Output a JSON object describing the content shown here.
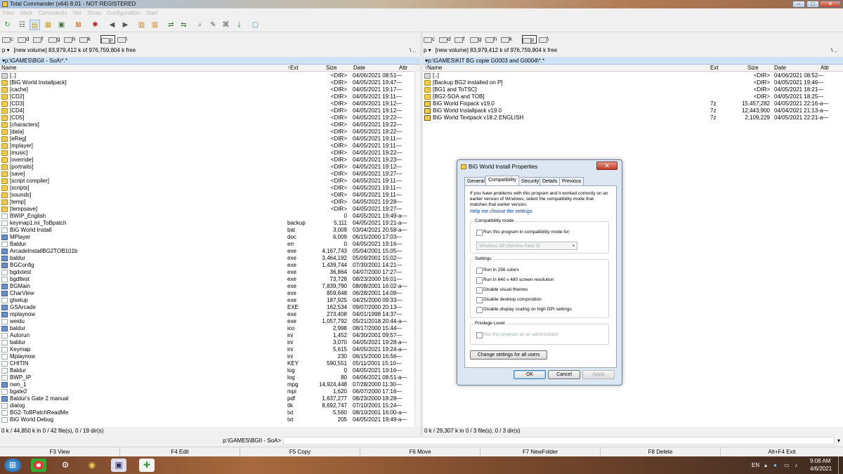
{
  "window": {
    "title": "Total Commander (x64) 8.01 - NOT REGISTERED",
    "min": "–",
    "max": "□",
    "close": "✕"
  },
  "menu": [
    "Files",
    "Mark",
    "Commands",
    "Net",
    "Show",
    "Configuration",
    "Start"
  ],
  "drives": [
    "c",
    "d",
    "f",
    "g",
    "h",
    "k",
    "p",
    "\\"
  ],
  "selected_drive": "p",
  "left": {
    "drive_sel": "p",
    "volume": "[new volume]  83,979,412 k of 976,759,804 k free",
    "path": "▾p:\\GAMES\\BGII - SoA\\*.*",
    "cols": {
      "name": "Name",
      "ext": "↑Ext",
      "size": "Size",
      "date": "Date",
      "attr": "Attr"
    },
    "rows": [
      {
        "i": "up",
        "n": "[..]",
        "e": "",
        "s": "<DIR>",
        "d": "04/06/2021 08:51—"
      },
      {
        "i": "folder",
        "n": "[BiG World Installpack]",
        "e": "",
        "s": "<DIR>",
        "d": "04/05/2021 19:47—"
      },
      {
        "i": "folder",
        "n": "[cache]",
        "e": "",
        "s": "<DIR>",
        "d": "04/05/2021 19:17—"
      },
      {
        "i": "folder",
        "n": "[CD2]",
        "e": "",
        "s": "<DIR>",
        "d": "04/05/2021 19:11—"
      },
      {
        "i": "folder",
        "n": "[CD3]",
        "e": "",
        "s": "<DIR>",
        "d": "04/05/2021 19:12—"
      },
      {
        "i": "folder",
        "n": "[CD4]",
        "e": "",
        "s": "<DIR>",
        "d": "04/05/2021 19:12—"
      },
      {
        "i": "folder",
        "n": "[CD5]",
        "e": "",
        "s": "<DIR>",
        "d": "04/05/2021 19:22—"
      },
      {
        "i": "folder",
        "n": "[characters]",
        "e": "",
        "s": "<DIR>",
        "d": "04/05/2021 19:22—"
      },
      {
        "i": "folder",
        "n": "[data]",
        "e": "",
        "s": "<DIR>",
        "d": "04/05/2021 19:22—"
      },
      {
        "i": "folder",
        "n": "[eReg]",
        "e": "",
        "s": "<DIR>",
        "d": "04/05/2021 19:11—"
      },
      {
        "i": "folder",
        "n": "[mplayer]",
        "e": "",
        "s": "<DIR>",
        "d": "04/05/2021 19:11—"
      },
      {
        "i": "folder",
        "n": "[music]",
        "e": "",
        "s": "<DIR>",
        "d": "04/05/2021 19:22—"
      },
      {
        "i": "folder",
        "n": "[override]",
        "e": "",
        "s": "<DIR>",
        "d": "04/05/2021 19:23—"
      },
      {
        "i": "folder",
        "n": "[portraits]",
        "e": "",
        "s": "<DIR>",
        "d": "04/05/2021 19:12—"
      },
      {
        "i": "folder",
        "n": "[save]",
        "e": "",
        "s": "<DIR>",
        "d": "04/05/2021 19:27—"
      },
      {
        "i": "folder",
        "n": "[script compiler]",
        "e": "",
        "s": "<DIR>",
        "d": "04/05/2021 19:11—"
      },
      {
        "i": "folder",
        "n": "[scripts]",
        "e": "",
        "s": "<DIR>",
        "d": "04/05/2021 19:11—"
      },
      {
        "i": "folder",
        "n": "[sounds]",
        "e": "",
        "s": "<DIR>",
        "d": "04/05/2021 19:11—"
      },
      {
        "i": "folder",
        "n": "[temp]",
        "e": "",
        "s": "<DIR>",
        "d": "04/05/2021 19:28—"
      },
      {
        "i": "folder",
        "n": "[tempsave]",
        "e": "",
        "s": "<DIR>",
        "d": "04/05/2021 19:27—"
      },
      {
        "i": "file",
        "n": "BWIP_English",
        "e": "",
        "s": "0",
        "d": "04/05/2021 19:49-a—"
      },
      {
        "i": "file",
        "n": "keymap1.ini_ToBpatch",
        "e": "backup",
        "s": "5,111",
        "d": "04/05/2021 19:21-a—"
      },
      {
        "i": "file",
        "n": "BiG World Install",
        "e": "bat",
        "s": "3,009",
        "d": "03/04/2021 20:58-a—"
      },
      {
        "i": "exe",
        "n": "MPlayer",
        "e": "doc",
        "s": "6,009",
        "d": "06/15/2000 17:03—"
      },
      {
        "i": "file",
        "n": "Baldur",
        "e": "err",
        "s": "0",
        "d": "04/05/2021 19:16—"
      },
      {
        "i": "exe",
        "n": "ArcadeInstallBG2TOB101b",
        "e": "exe",
        "s": "4,167,743",
        "d": "05/04/2001 15:05—"
      },
      {
        "i": "exe",
        "n": "baldur",
        "e": "exe",
        "s": "3,464,192",
        "d": "05/09/2001 15:02—"
      },
      {
        "i": "exe",
        "n": "BGConfig",
        "e": "exe",
        "s": "1,439,744",
        "d": "07/30/2001 14:21—"
      },
      {
        "i": "file",
        "n": "bgdxtest",
        "e": "exe",
        "s": "36,864",
        "d": "04/07/2000 17:27—"
      },
      {
        "i": "file",
        "n": "bgdltest",
        "e": "exe",
        "s": "73,728",
        "d": "08/23/2000 16:01—"
      },
      {
        "i": "exe",
        "n": "BGMain",
        "e": "exe",
        "s": "7,839,790",
        "d": "08/08/2001 16:02-a—"
      },
      {
        "i": "exe",
        "n": "CharView",
        "e": "exe",
        "s": "859,648",
        "d": "06/28/2001 14:09—"
      },
      {
        "i": "file",
        "n": "glsetup",
        "e": "exe",
        "s": "187,925",
        "d": "04/25/2000 09:33—"
      },
      {
        "i": "exe",
        "n": "GSArcade",
        "e": "EXE",
        "s": "162,534",
        "d": "09/07/2000 20:13—"
      },
      {
        "i": "exe",
        "n": "mplaynow",
        "e": "exe",
        "s": "273,408",
        "d": "04/01/1998 14:37—"
      },
      {
        "i": "file",
        "n": "weidu",
        "e": "exe",
        "s": "1,057,792",
        "d": "05/21/2018 20:44-a—"
      },
      {
        "i": "exe",
        "n": "baldur",
        "e": "ico",
        "s": "2,998",
        "d": "08/17/2000 15:44—"
      },
      {
        "i": "file",
        "n": "Autorun",
        "e": "ini",
        "s": "1,452",
        "d": "04/30/2001 09:57—"
      },
      {
        "i": "file",
        "n": "baldur",
        "e": "ini",
        "s": "3,070",
        "d": "04/05/2021 19:28-a—"
      },
      {
        "i": "file",
        "n": "Keymap",
        "e": "ini",
        "s": "5,615",
        "d": "04/05/2021 19:24-a—"
      },
      {
        "i": "file",
        "n": "Mplaynow",
        "e": "ini",
        "s": "230",
        "d": "06/15/2000 16:56—"
      },
      {
        "i": "file",
        "n": "CHITIN",
        "e": "KEY",
        "s": "590,551",
        "d": "05/11/2001 15:10—"
      },
      {
        "i": "file",
        "n": "Baldur",
        "e": "log",
        "s": "0",
        "d": "04/05/2021 19:16—"
      },
      {
        "i": "file",
        "n": "BWP_IP",
        "e": "log",
        "s": "80",
        "d": "04/06/2021 08:51-a—"
      },
      {
        "i": "exe",
        "n": "nwn_1",
        "e": "mpg",
        "s": "14,924,448",
        "d": "07/28/2000 11:30—"
      },
      {
        "i": "file",
        "n": "bgate2",
        "e": "mpi",
        "s": "1,620",
        "d": "06/07/2000 17:16—"
      },
      {
        "i": "exe",
        "n": "Baldur's Gate 2 manual",
        "e": "pdf",
        "s": "1,637,277",
        "d": "08/23/2000 18:28—"
      },
      {
        "i": "file",
        "n": "dialog",
        "e": "tlk",
        "s": "8,692,747",
        "d": "07/10/2001 15:24—"
      },
      {
        "i": "file",
        "n": "BG2-ToBPatchReadMe",
        "e": "txt",
        "s": "5,560",
        "d": "08/10/2001 16:00-a—"
      },
      {
        "i": "file",
        "n": "BiG World Debug",
        "e": "txt",
        "s": "205",
        "d": "04/05/2021 19:49-a—"
      }
    ],
    "status": "0 k / 44,850 k in 0 / 42 file(s), 0 / 19 dir(s)"
  },
  "right": {
    "drive_sel": "p",
    "volume": "[new volume]  83,979,412 k of 976,759,804 k free",
    "path": "▾p:\\GAMES\\KIT BG copie G0003 and G0004\\*.*",
    "cols": {
      "name": "↑Name",
      "ext": "Ext",
      "size": "Size",
      "date": "Date",
      "attr": "Attr"
    },
    "rows": [
      {
        "i": "up",
        "n": "[..]",
        "e": "",
        "s": "<DIR>",
        "d": "04/06/2021 08:52—"
      },
      {
        "i": "folder",
        "n": "[Backup BG2 installed on P]",
        "e": "",
        "s": "<DIR>",
        "d": "04/05/2021 19:46—"
      },
      {
        "i": "folder",
        "n": "[BG1 and ToTSC]",
        "e": "",
        "s": "<DIR>",
        "d": "04/05/2021 18:21—"
      },
      {
        "i": "folder",
        "n": "[BG2-SOA and TOB]",
        "e": "",
        "s": "<DIR>",
        "d": "04/05/2021 18:25—"
      },
      {
        "i": "zip",
        "n": "BiG World Fixpack v19.0",
        "e": "7z",
        "s": "15,457,282",
        "d": "04/05/2021 22:16-a—"
      },
      {
        "i": "zip",
        "n": "BiG World Installpack v19.0",
        "e": "7z",
        "s": "12,443,900",
        "d": "04/04/2021 21:13-a—"
      },
      {
        "i": "zip",
        "n": "BiG World Textpack v18.2 ENGLISH",
        "e": "7z",
        "s": "2,109,229",
        "d": "04/05/2021 22:21-a—"
      }
    ],
    "status": "0 k / 29,307 k in 0 / 3 file(s), 0 / 3 dir(s)"
  },
  "cmdline": {
    "label": "p:\\GAMES\\BGII - SoA>"
  },
  "fkeys": [
    "F3 View",
    "F4 Edit",
    "F5 Copy",
    "F6 Move",
    "F7 NewFolder",
    "F8 Delete",
    "Alt+F4 Exit"
  ],
  "dialog": {
    "title": "BiG World Install Properties",
    "tabs": [
      "General",
      "Compatibility",
      "Security",
      "Details",
      "Previous Versions"
    ],
    "active_tab": "Compatibility",
    "intro": "If you have problems with this program and it worked correctly on an earlier version of Windows, select the compatibility mode that matches that earlier version.",
    "help_link": "Help me choose the settings",
    "compat_group": "Compatibility mode",
    "compat_check": "Run this program in compatibility mode for:",
    "compat_combo": "Windows XP (Service Pack 3)",
    "settings_group": "Settings",
    "settings": [
      "Run in 256 colors",
      "Run in 640 x 480 screen resolution",
      "Disable visual themes",
      "Disable desktop composition",
      "Disable display scaling on high DPI settings"
    ],
    "priv_group": "Privilege Level",
    "priv_check": "Run this program as an administrator",
    "change_all": "Change settings for all users",
    "ok": "OK",
    "cancel": "Cancel",
    "apply": "Apply"
  },
  "tray": {
    "lang": "EN",
    "time": "9:08 AM",
    "date": "4/6/2021"
  }
}
